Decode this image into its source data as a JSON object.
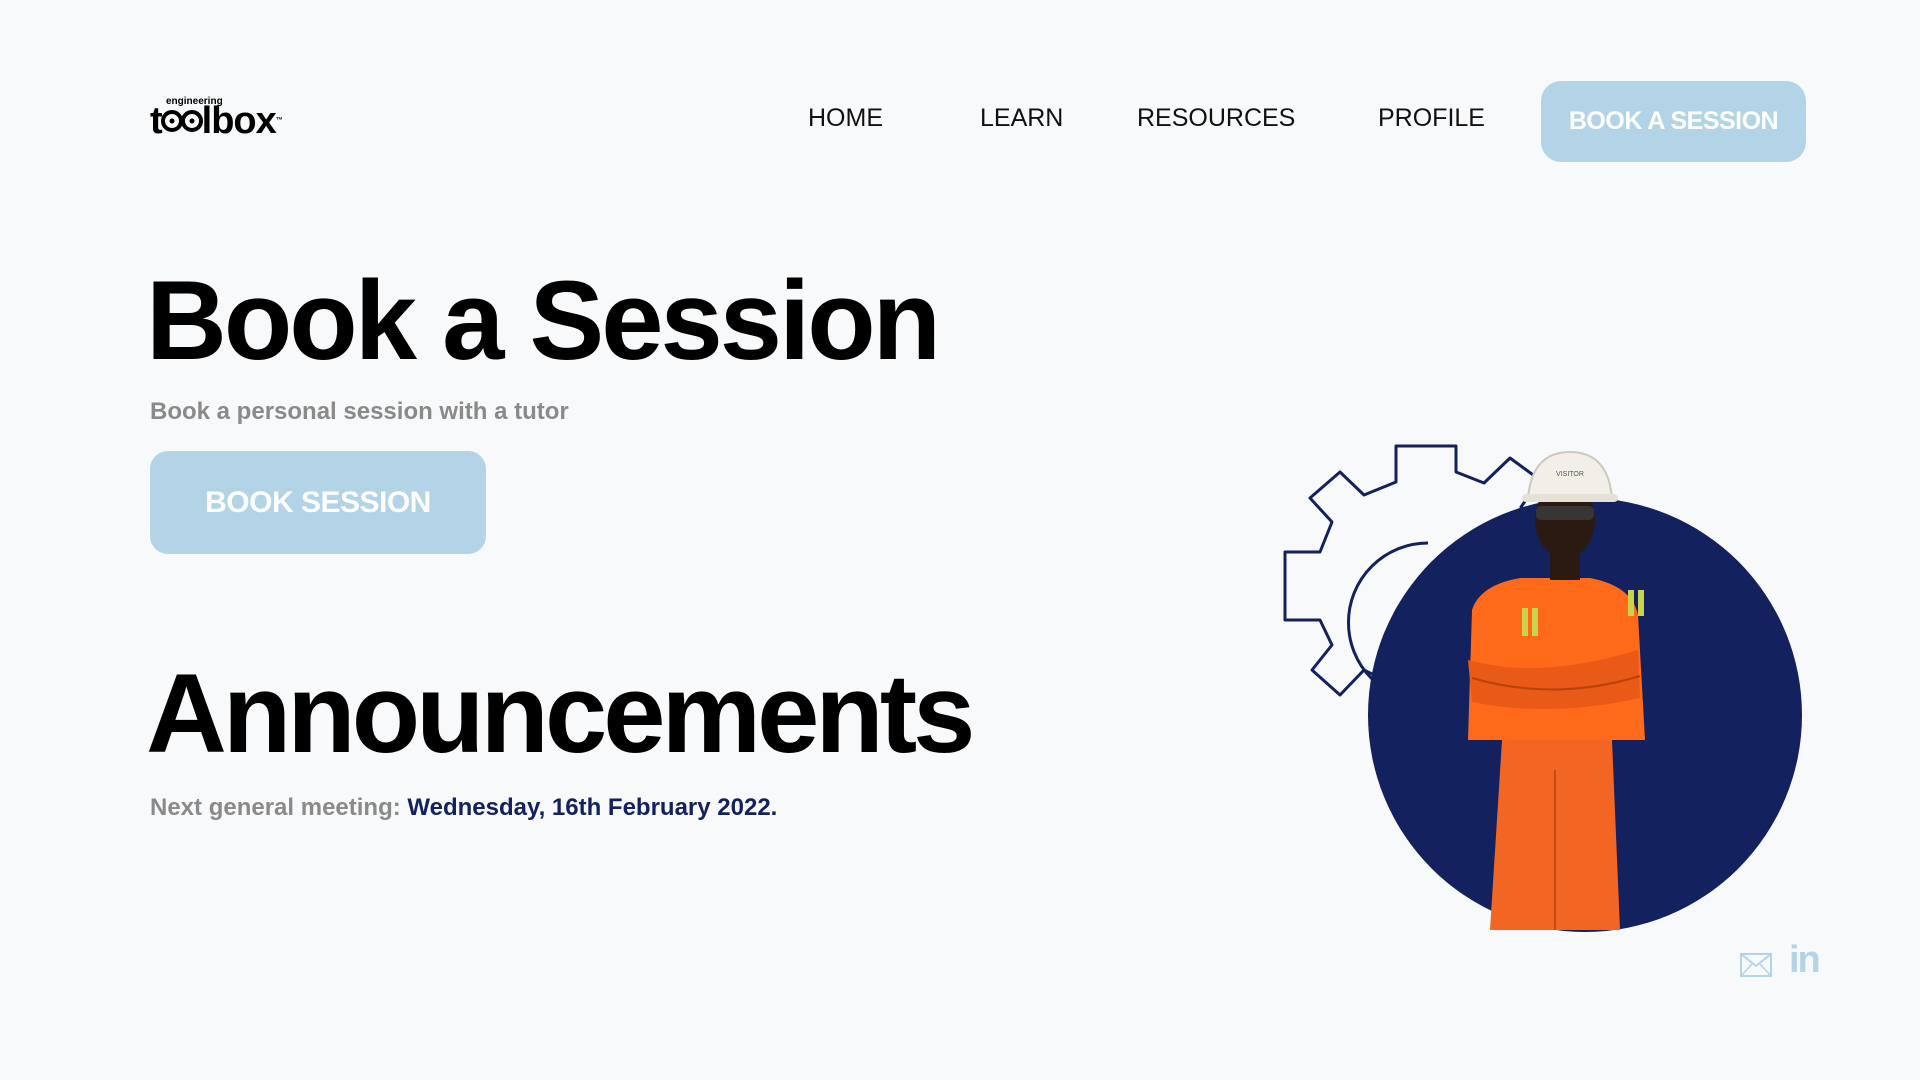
{
  "brand": {
    "logo_small": "engineering",
    "logo_pre": "t",
    "logo_post": "lbox",
    "logo_tm": "™"
  },
  "nav": {
    "items": [
      {
        "label": "HOME"
      },
      {
        "label": "LEARN"
      },
      {
        "label": "RESOURCES"
      },
      {
        "label": "PROFILE"
      }
    ],
    "cta_label": "BOOK A SESSION"
  },
  "hero": {
    "title": "Book a Session",
    "subtitle": "Book a personal session with a tutor",
    "button_label": "BOOK SESSION"
  },
  "announcements": {
    "title": "Announcements",
    "text_prefix": "Next general meeting: ",
    "date": "Wednesday, 16th February 2022."
  },
  "illustration": {
    "helmet_text": "VISITOR"
  },
  "social": {
    "icons": [
      "mail-icon",
      "linkedin-icon"
    ],
    "linkedin_glyph": "in"
  },
  "colors": {
    "accent": "#b3d4e6",
    "navy": "#13215e",
    "orange": "#ff6a1a",
    "background": "#f8f9fa",
    "muted_text": "#8a8a8a"
  }
}
